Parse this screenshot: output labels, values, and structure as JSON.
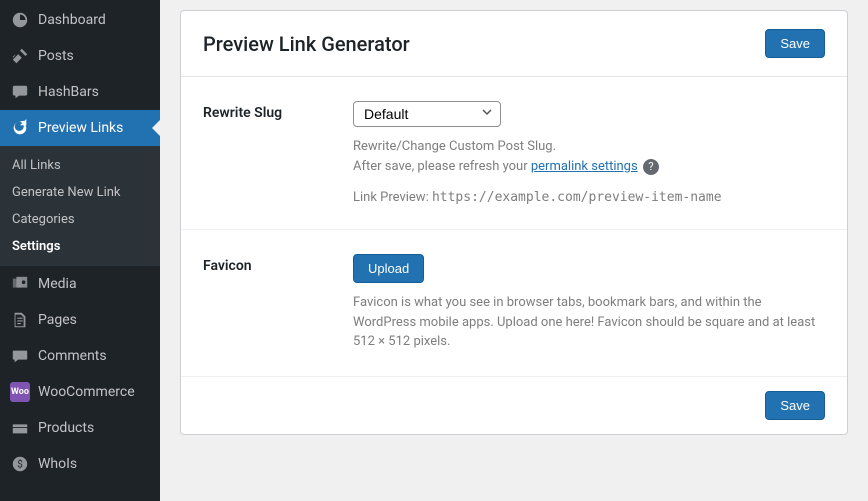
{
  "sidebar": {
    "items": [
      {
        "label": "Dashboard",
        "icon": "dashboard"
      },
      {
        "label": "Posts",
        "icon": "pin"
      },
      {
        "label": "HashBars",
        "icon": "chat"
      },
      {
        "label": "Preview Links",
        "icon": "redo",
        "active": true
      },
      {
        "label": "Media",
        "icon": "media"
      },
      {
        "label": "Pages",
        "icon": "page"
      },
      {
        "label": "Comments",
        "icon": "comment"
      },
      {
        "label": "WooCommerce",
        "icon": "woo"
      },
      {
        "label": "Products",
        "icon": "products"
      },
      {
        "label": "WhoIs",
        "icon": "money"
      }
    ],
    "submenu": [
      "All Links",
      "Generate New Link",
      "Categories",
      "Settings"
    ],
    "submenu_current": "Settings"
  },
  "page": {
    "title": "Preview Link Generator",
    "save_label": "Save"
  },
  "rewrite": {
    "label": "Rewrite Slug",
    "select_value": "Default",
    "desc_line1": "Rewrite/Change Custom Post Slug.",
    "desc_line2_a": "After save, please refresh your ",
    "desc_link": "permalink settings",
    "preview_prefix": "Link Preview: ",
    "preview_url": "https://example.com/preview-item-name"
  },
  "favicon": {
    "label": "Favicon",
    "upload_label": "Upload",
    "desc": "Favicon is what you see in browser tabs, bookmark bars, and within the WordPress mobile apps. Upload one here! Favicon should be square and at least 512 × 512 pixels."
  }
}
